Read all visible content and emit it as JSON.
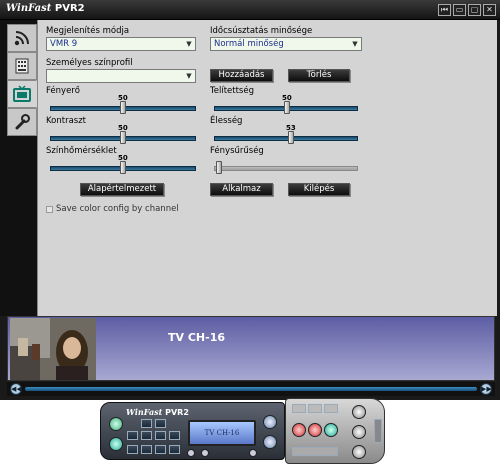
{
  "app": {
    "title_brand": "WinFast",
    "title_version": "PVR2"
  },
  "window_buttons": [
    "⏮",
    "▭",
    "▢",
    "✕"
  ],
  "tabs": [
    {
      "name": "tab-record-icon"
    },
    {
      "name": "tab-keyboard-icon"
    },
    {
      "name": "tab-tv-icon"
    },
    {
      "name": "tab-settings-icon"
    }
  ],
  "settings": {
    "render_mode_label": "Megjelenítés módja",
    "render_mode_value": "VMR 9",
    "deinterlace_label": "Időcsúsztatás minősége",
    "deinterlace_value": "Normál minőség",
    "color_profile_label": "Személyes színprofil",
    "color_profile_value": "",
    "add_button": "Hozzáadás",
    "delete_button": "Törlés",
    "brightness_label": "Fényerő",
    "brightness_value": "50",
    "saturation_label": "Telítettség",
    "saturation_value": "50",
    "contrast_label": "Kontraszt",
    "contrast_value": "50",
    "sharpness_label": "Élesség",
    "sharpness_value": "53",
    "color_temp_label": "Színhőmérséklet",
    "color_temp_value": "50",
    "gamma_label": "Fénysűrűség",
    "default_button": "Alapértelmezett",
    "apply_button": "Alkalmaz",
    "exit_button": "Kilépés",
    "save_per_channel_label": "Save color config by channel"
  },
  "preview": {
    "channel": "TV CH-16"
  },
  "remote": {
    "brand": "WinFast",
    "version": "PVR2",
    "lcd_text": "TV CH-16"
  },
  "colors": {
    "slider_track": "#2a6a90",
    "panel_bg": "#d4d4d4",
    "combo_text": "#1a2d8a",
    "preview_gradient_top": "#5d5da4"
  }
}
